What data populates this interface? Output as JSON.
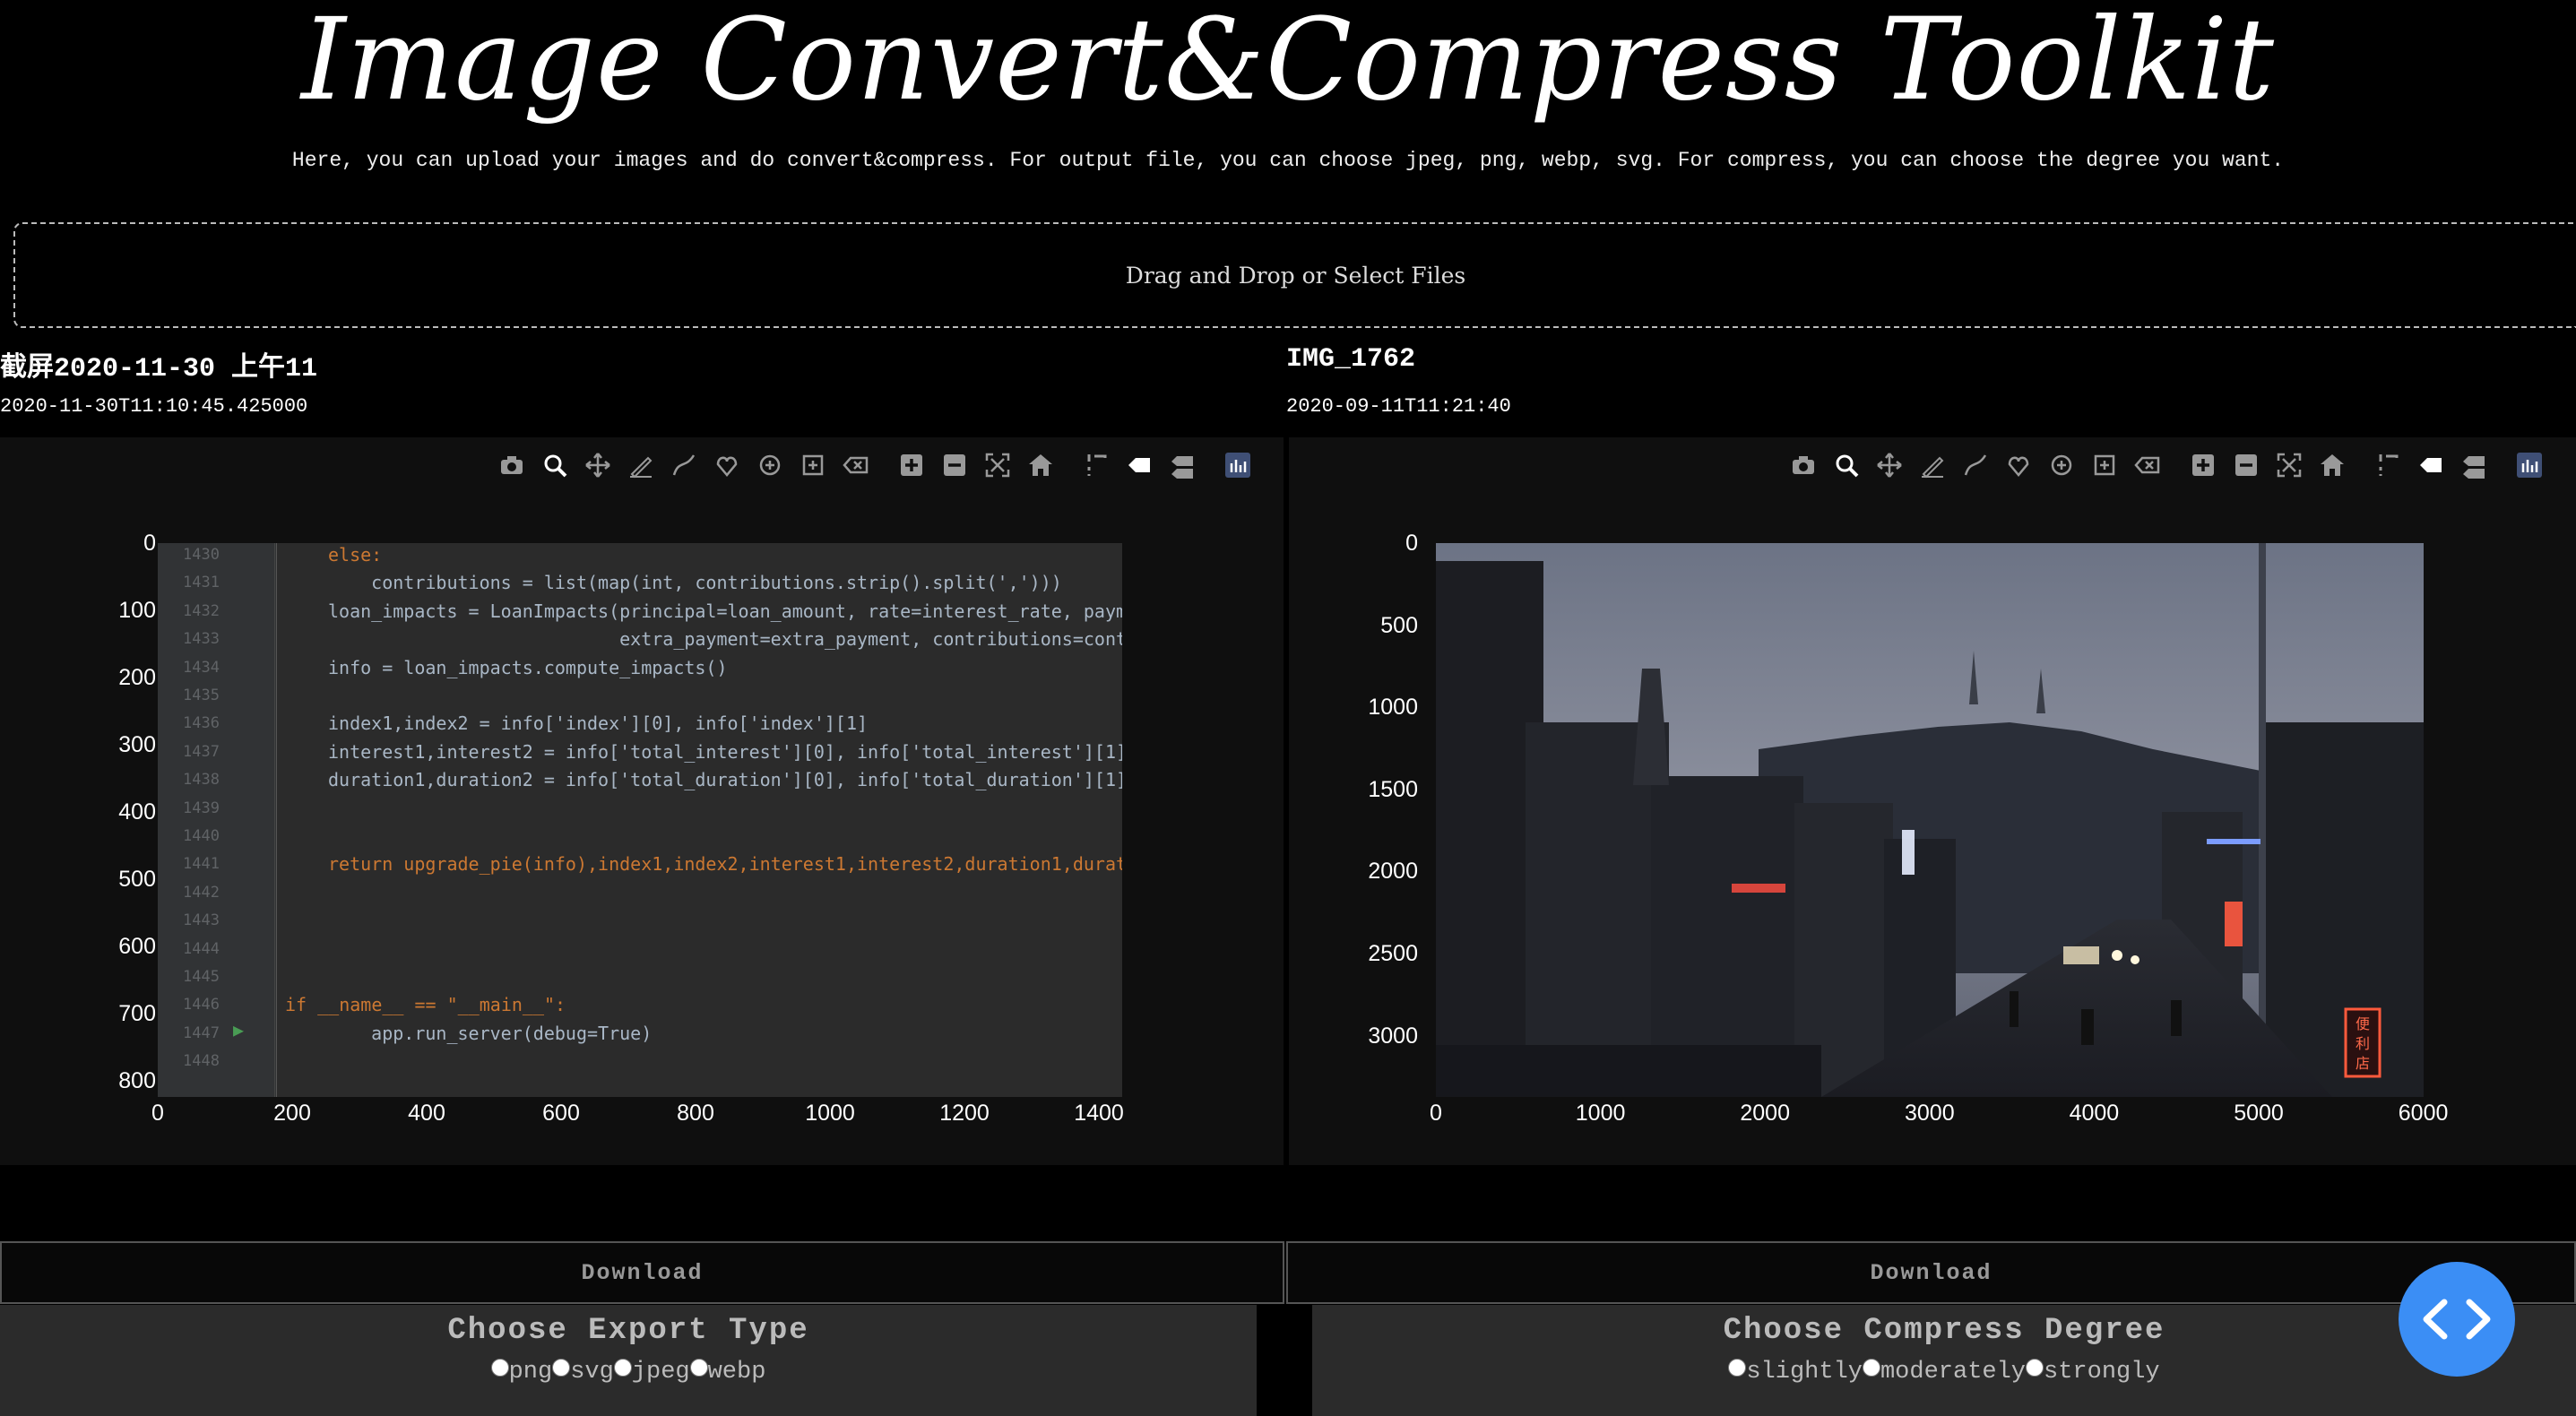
{
  "header": {
    "title": "Image Convert&Compress Toolkit",
    "subtitle": "Here, you can upload your images and do convert&compress. For output file, you can choose jpeg, png, webp, svg. For compress, you can choose the degree you want."
  },
  "upload": {
    "label": "Drag and Drop or Select Files"
  },
  "left": {
    "filename": "截屏2020-11-30 上午11",
    "timestamp": "2020-11-30T11:10:45.425000",
    "yticks": [
      "0",
      "100",
      "200",
      "300",
      "400",
      "500",
      "600",
      "700",
      "800"
    ],
    "xticks": [
      "0",
      "200",
      "400",
      "600",
      "800",
      "1000",
      "1200",
      "1400"
    ],
    "download_label": "Download",
    "panel_title": "Choose Export Type",
    "options": [
      "png",
      "svg",
      "jpeg",
      "webp"
    ]
  },
  "right": {
    "filename": "IMG_1762",
    "timestamp": "2020-09-11T11:21:40",
    "yticks": [
      "0",
      "500",
      "1000",
      "1500",
      "2000",
      "2500",
      "3000"
    ],
    "xticks": [
      "0",
      "1000",
      "2000",
      "3000",
      "4000",
      "5000",
      "6000"
    ],
    "download_label": "Download",
    "panel_title": "Choose Compress Degree",
    "options": [
      "slightly",
      "moderately",
      "strongly"
    ],
    "street_sign_1": "便",
    "street_sign_2": "利",
    "street_sign_3": "店"
  },
  "code_lines": [
    {
      "n": "1430",
      "t": "else:"
    },
    {
      "n": "1431",
      "t": "    contributions = list(map(int, contributions.strip().split(',')))"
    },
    {
      "n": "1432",
      "t": "loan_impacts = LoanImpacts(principal=loan_amount, rate=interest_rate, paym"
    },
    {
      "n": "1433",
      "t": "                           extra_payment=extra_payment, contributions=cont"
    },
    {
      "n": "1434",
      "t": "info = loan_impacts.compute_impacts()"
    },
    {
      "n": "1435",
      "t": ""
    },
    {
      "n": "1436",
      "t": "index1,index2 = info['index'][0], info['index'][1]"
    },
    {
      "n": "1437",
      "t": "interest1,interest2 = info['total_interest'][0], info['total_interest'][1]"
    },
    {
      "n": "1438",
      "t": "duration1,duration2 = info['total_duration'][0], info['total_duration'][1]"
    },
    {
      "n": "1439",
      "t": ""
    },
    {
      "n": "1440",
      "t": ""
    },
    {
      "n": "1441",
      "t": "return upgrade_pie(info),index1,index2,interest1,interest2,duration1,durat"
    },
    {
      "n": "1442",
      "t": ""
    },
    {
      "n": "1443",
      "t": ""
    },
    {
      "n": "1444",
      "t": ""
    },
    {
      "n": "1445",
      "t": ""
    },
    {
      "n": "1446",
      "t": "if __name__ == \"__main__\":"
    },
    {
      "n": "1447",
      "t": "    app.run_server(debug=True)"
    },
    {
      "n": "1448",
      "t": ""
    }
  ],
  "modebar_icons": [
    "camera-icon",
    "zoom-icon",
    "pan-icon",
    "draw-line-icon",
    "draw-open-path-icon",
    "draw-closed-path-icon",
    "draw-circle-icon",
    "draw-rect-icon",
    "erase-shape-icon",
    "zoom-in-icon",
    "zoom-out-icon",
    "autoscale-icon",
    "reset-axes-icon",
    "spike-lines-icon",
    "hover-closest-icon",
    "hover-compare-icon",
    "plotly-logo-icon"
  ],
  "colors": {
    "accent": "#3b8ef5",
    "code_bg": "#2b2b2b",
    "panel_bg": "#2b2b2b"
  }
}
